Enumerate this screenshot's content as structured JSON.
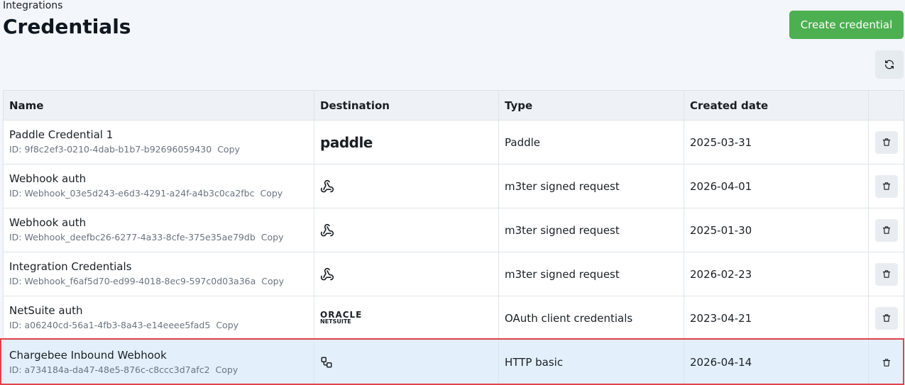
{
  "header": {
    "breadcrumb": "Integrations",
    "title": "Credentials",
    "create_button": "Create credential"
  },
  "table": {
    "columns": [
      "Name",
      "Destination",
      "Type",
      "Created date"
    ],
    "rows": [
      {
        "name": "Paddle Credential 1",
        "id": "ID: 9f8c2ef3-0210-4dab-b1b7-b92696059430",
        "copy": "Copy",
        "destination": "paddle",
        "destination_icon": "paddle-logo",
        "type": "Paddle",
        "created": "2025-03-31"
      },
      {
        "name": "Webhook auth",
        "id": "ID: Webhook_03e5d243-e6d3-4291-a24f-a4b3c0ca2fbc",
        "copy": "Copy",
        "destination_icon": "webhook-icon",
        "type": "m3ter signed request",
        "created": "2026-04-01"
      },
      {
        "name": "Webhook auth",
        "id": "ID: Webhook_deefbc26-6277-4a33-8cfe-375e35ae79db",
        "copy": "Copy",
        "destination_icon": "webhook-icon",
        "type": "m3ter signed request",
        "created": "2025-01-30"
      },
      {
        "name": "Integration Credentials",
        "id": "ID: Webhook_f6af5d70-ed99-4018-8ec9-597c0d03a36a",
        "copy": "Copy",
        "destination_icon": "webhook-icon",
        "type": "m3ter signed request",
        "created": "2026-02-23"
      },
      {
        "name": "NetSuite auth",
        "id": "ID: a06240cd-56a1-4fb3-8a43-e14eeee5fad5",
        "copy": "Copy",
        "destination": "ORACLE",
        "destination_sub": "NETSUITE",
        "destination_icon": "oracle-netsuite-logo",
        "type": "OAuth client credentials",
        "created": "2023-04-21"
      },
      {
        "name": "Chargebee Inbound Webhook",
        "id": "ID: a734184a-da47-48e5-876c-c8ccc3d7afc2",
        "copy": "Copy",
        "destination_icon": "http-link-icon",
        "type": "HTTP basic",
        "created": "2026-04-14"
      }
    ]
  },
  "colors": {
    "accent_green": "#4caf50",
    "selected_row": "#e3f0fb",
    "selection_outline": "#e0434b"
  }
}
